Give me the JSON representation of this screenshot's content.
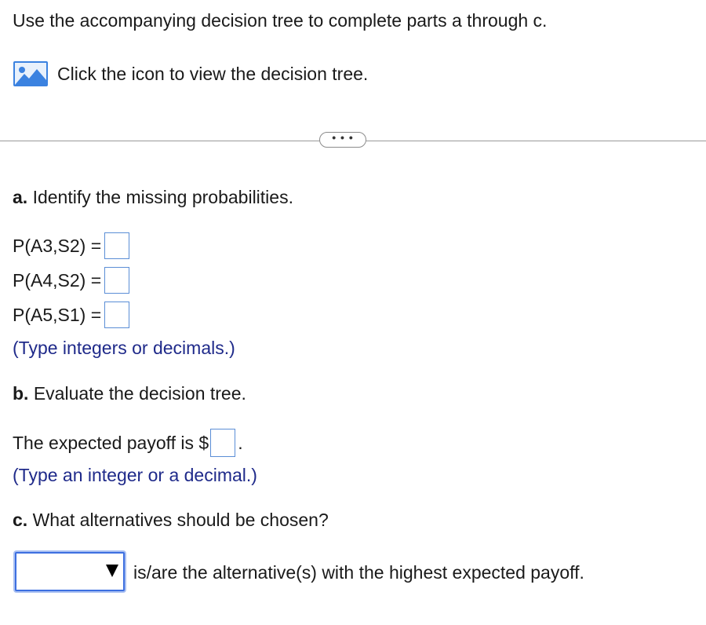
{
  "intro": "Use the accompanying decision tree to complete parts a through c.",
  "icon_link": {
    "icon": "image-icon",
    "label": "Click the icon to view the decision tree."
  },
  "more_button": "• • •",
  "part_a": {
    "prefix": "a.",
    "question": " Identify the missing probabilities.",
    "rows": [
      {
        "label": "P(A3,S2) =",
        "value": ""
      },
      {
        "label": "P(A4,S2) =",
        "value": ""
      },
      {
        "label": "P(A5,S1) =",
        "value": ""
      }
    ],
    "note": "(Type integers or decimals.)"
  },
  "part_b": {
    "prefix": "b.",
    "question": " Evaluate the decision tree.",
    "payoff_prefix": "The expected payoff is $",
    "payoff_value": "",
    "payoff_suffix": ".",
    "note": "(Type an integer or a decimal.)"
  },
  "part_c": {
    "prefix": "c.",
    "question": " What alternatives should be chosen?",
    "dropdown_value": "",
    "suffix": "is/are the alternative(s) with the highest expected payoff."
  },
  "colors": {
    "note_blue": "#1f2a8a",
    "input_border": "#5b8ed6",
    "dropdown_border": "#3d6fe0"
  }
}
